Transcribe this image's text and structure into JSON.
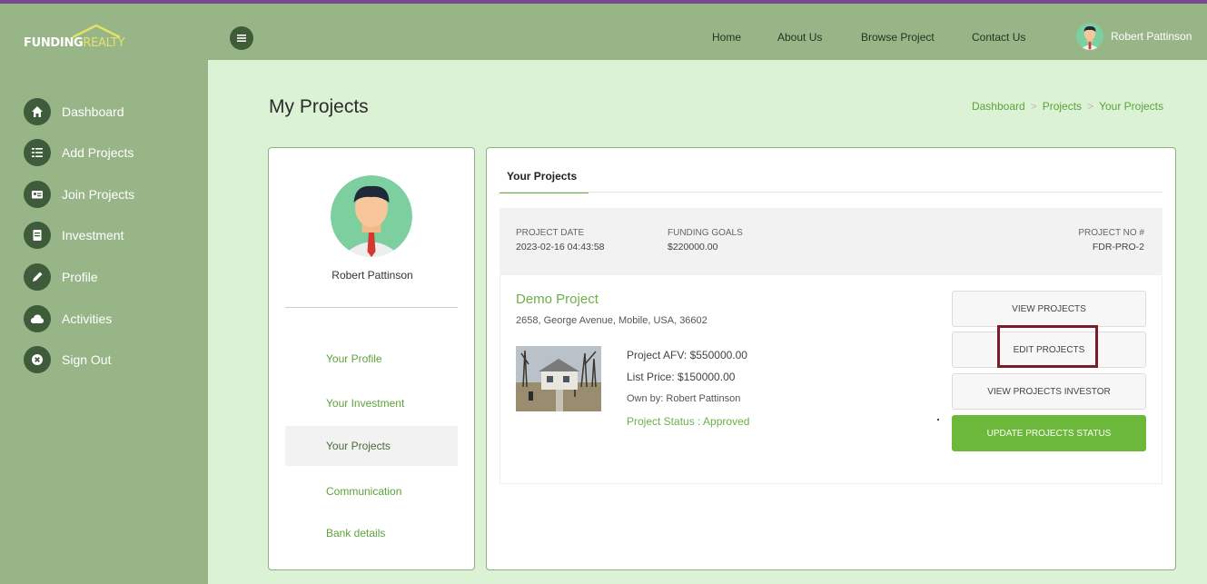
{
  "brand": {
    "logo_text_a": "FUNDING",
    "logo_text_b": "REALTY"
  },
  "topnav": {
    "items": [
      "Home",
      "About Us",
      "Browse Project",
      "Contact Us"
    ],
    "user_name": "Robert Pattinson"
  },
  "sidebar": {
    "items": [
      {
        "label": "Dashboard",
        "icon": "home-icon"
      },
      {
        "label": "Add Projects",
        "icon": "list-icon"
      },
      {
        "label": "Join Projects",
        "icon": "id-card-icon"
      },
      {
        "label": "Investment",
        "icon": "document-icon"
      },
      {
        "label": "Profile",
        "icon": "pencil-icon"
      },
      {
        "label": "Activities",
        "icon": "cloud-icon"
      },
      {
        "label": "Sign Out",
        "icon": "close-icon"
      }
    ]
  },
  "page": {
    "title": "My Projects",
    "breadcrumb": [
      "Dashboard",
      "Projects",
      "Your Projects"
    ],
    "breadcrumb_sep": ">"
  },
  "profile_card": {
    "name": "Robert Pattinson",
    "menu": [
      "Your Profile",
      "Your Investment",
      "Your Projects",
      "Communication",
      "Bank details"
    ],
    "active_index": 2
  },
  "projects_panel": {
    "tab": "Your Projects",
    "project_date_label": "PROJECT DATE",
    "project_date": "2023-02-16 04:43:58",
    "funding_goals_label": "FUNDING GOALS",
    "funding_goals": "$220000.00",
    "project_no_label": "PROJECT NO #",
    "project_no": "FDR-PRO-2",
    "project": {
      "name": "Demo Project",
      "address": "2658, George Avenue, Mobile, USA, 36602",
      "afv": "Project AFV: $550000.00",
      "list_price": "List Price: $150000.00",
      "owner": "Own by: Robert Pattinson",
      "status": "Project Status : Approved"
    },
    "buttons": {
      "view": "VIEW PROJECTS",
      "edit": "EDIT PROJECTS",
      "view_investor": "VIEW PROJECTS INVESTOR",
      "update_status": "UPDATE PROJECTS STATUS"
    }
  },
  "colors": {
    "accent_green": "#6cb049",
    "sidebar_bg": "#97b587",
    "content_bg": "#dcf2d5",
    "highlight": "#7a1d2a"
  }
}
